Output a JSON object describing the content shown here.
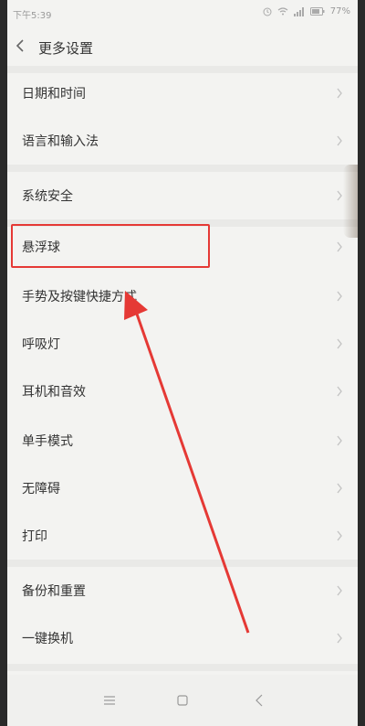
{
  "status_bar": {
    "time": "下午5:39",
    "battery": "77%"
  },
  "header": {
    "title": "更多设置"
  },
  "items": [
    {
      "label": "日期和时间"
    },
    {
      "label": "语言和输入法"
    },
    {
      "label": "系统安全"
    },
    {
      "label": "悬浮球"
    },
    {
      "label": "手势及按键快捷方式"
    },
    {
      "label": "呼吸灯"
    },
    {
      "label": "耳机和音效"
    },
    {
      "label": "单手模式"
    },
    {
      "label": "无障碍"
    },
    {
      "label": "打印"
    },
    {
      "label": "备份和重置"
    },
    {
      "label": "一键换机"
    }
  ],
  "icons": {
    "back": "chevron-left-icon",
    "chevron": "chevron-right-icon",
    "nav_menu": "menu-icon",
    "nav_home": "square-icon",
    "nav_back": "back-icon"
  },
  "colors": {
    "highlight": "#e53935",
    "background": "#f3f3f1"
  }
}
